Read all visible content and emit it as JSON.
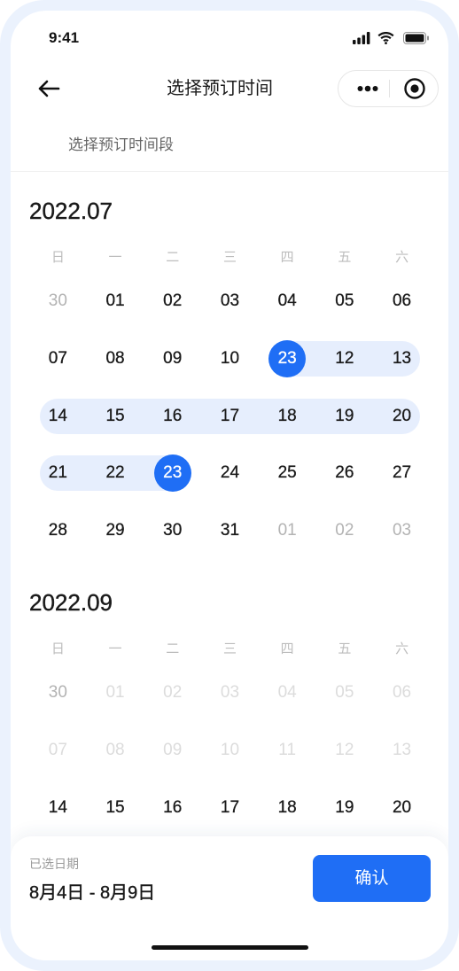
{
  "status_bar": {
    "time": "9:41",
    "icons": [
      "signal-icon",
      "wifi-icon",
      "battery-icon"
    ]
  },
  "nav": {
    "title": "选择预订时间",
    "icons": {
      "back": "arrow-left-icon",
      "more": "more-dots-icon",
      "target": "target-icon"
    }
  },
  "subtitle": "选择预订时间段",
  "weekdays": [
    "日",
    "一",
    "二",
    "三",
    "四",
    "五",
    "六"
  ],
  "months": [
    {
      "label": "2022.07",
      "weeks": [
        [
          {
            "d": "30",
            "muted": true
          },
          {
            "d": "01"
          },
          {
            "d": "02"
          },
          {
            "d": "03"
          },
          {
            "d": "04"
          },
          {
            "d": "05"
          },
          {
            "d": "06"
          }
        ],
        [
          {
            "d": "07"
          },
          {
            "d": "08"
          },
          {
            "d": "09"
          },
          {
            "d": "10"
          },
          {
            "d": "23",
            "selected": true,
            "range": true
          },
          {
            "d": "12",
            "range": true
          },
          {
            "d": "13",
            "range": true
          }
        ],
        [
          {
            "d": "14",
            "range": true
          },
          {
            "d": "15",
            "range": true
          },
          {
            "d": "16",
            "range": true
          },
          {
            "d": "17",
            "range": true
          },
          {
            "d": "18",
            "range": true
          },
          {
            "d": "19",
            "range": true
          },
          {
            "d": "20",
            "range": true
          }
        ],
        [
          {
            "d": "21",
            "range": true
          },
          {
            "d": "22",
            "range": true
          },
          {
            "d": "23",
            "selected": true,
            "range": true
          },
          {
            "d": "24"
          },
          {
            "d": "25"
          },
          {
            "d": "26"
          },
          {
            "d": "27"
          }
        ],
        [
          {
            "d": "28"
          },
          {
            "d": "29"
          },
          {
            "d": "30"
          },
          {
            "d": "31"
          },
          {
            "d": "01",
            "muted": true
          },
          {
            "d": "02",
            "muted": true
          },
          {
            "d": "03",
            "muted": true
          }
        ]
      ]
    },
    {
      "label": "2022.09",
      "weeks": [
        [
          {
            "d": "30",
            "muted": true
          },
          {
            "d": "01",
            "faded": true
          },
          {
            "d": "02",
            "faded": true
          },
          {
            "d": "03",
            "faded": true
          },
          {
            "d": "04",
            "faded": true
          },
          {
            "d": "05",
            "faded": true
          },
          {
            "d": "06",
            "faded": true
          }
        ],
        [
          {
            "d": "07",
            "faded": true
          },
          {
            "d": "08",
            "faded": true
          },
          {
            "d": "09",
            "faded": true
          },
          {
            "d": "10",
            "faded": true
          },
          {
            "d": "11",
            "faded": true
          },
          {
            "d": "12",
            "faded": true
          },
          {
            "d": "13",
            "faded": true
          }
        ],
        [
          {
            "d": "14"
          },
          {
            "d": "15"
          },
          {
            "d": "16"
          },
          {
            "d": "17"
          },
          {
            "d": "18"
          },
          {
            "d": "19"
          },
          {
            "d": "20"
          }
        ]
      ]
    }
  ],
  "footer": {
    "selected_label": "已选日期",
    "selected_range": "8月4日 - 8月9日",
    "confirm_label": "确认"
  },
  "colors": {
    "primary": "#1f6ef5",
    "range": "#e6eefd",
    "frame": "#ebf2fd",
    "text": "#1a1a1a",
    "muted": "#b3b3b3",
    "faded": "#dcdcdc"
  }
}
